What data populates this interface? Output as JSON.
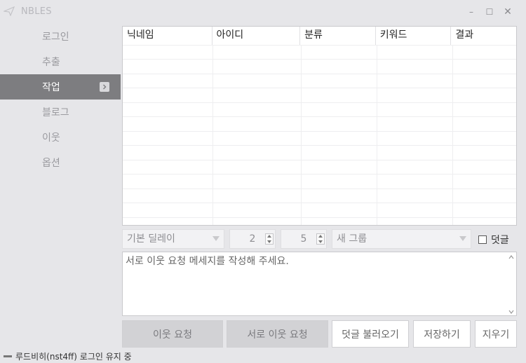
{
  "window": {
    "title": "NBLES",
    "minimize": "–",
    "maximize": "☐",
    "close": "✕"
  },
  "sidebar": {
    "items": [
      {
        "label": "로그인"
      },
      {
        "label": "추출"
      },
      {
        "label": "작업"
      },
      {
        "label": "블로그"
      },
      {
        "label": "이웃"
      },
      {
        "label": "옵션"
      }
    ],
    "active_index": 2
  },
  "table": {
    "columns": [
      "닉네임",
      "아이디",
      "분류",
      "키워드",
      "결과"
    ],
    "rows": []
  },
  "controls": {
    "delay_select": "기본 딜레이",
    "delay_min": "2",
    "delay_max": "5",
    "group_select": "새 그룹",
    "comment_checkbox_label": "덧글",
    "comment_checked": false
  },
  "message": {
    "placeholder": "서로 이웃 요청 메세지를 작성해 주세요."
  },
  "buttons": {
    "neighbor_request": "이웃 요청",
    "mutual_request": "서로 이웃 요청",
    "load_comments": "덧글 불러오기",
    "save": "저장하기",
    "clear": "지우기"
  },
  "status": {
    "text": "루드비히(nst4ff) 로그인 유지 중"
  },
  "colors": {
    "background": "#e6e6e9",
    "sidebar_active": "#7d7d80",
    "button_grey": "#d2d2d5"
  }
}
